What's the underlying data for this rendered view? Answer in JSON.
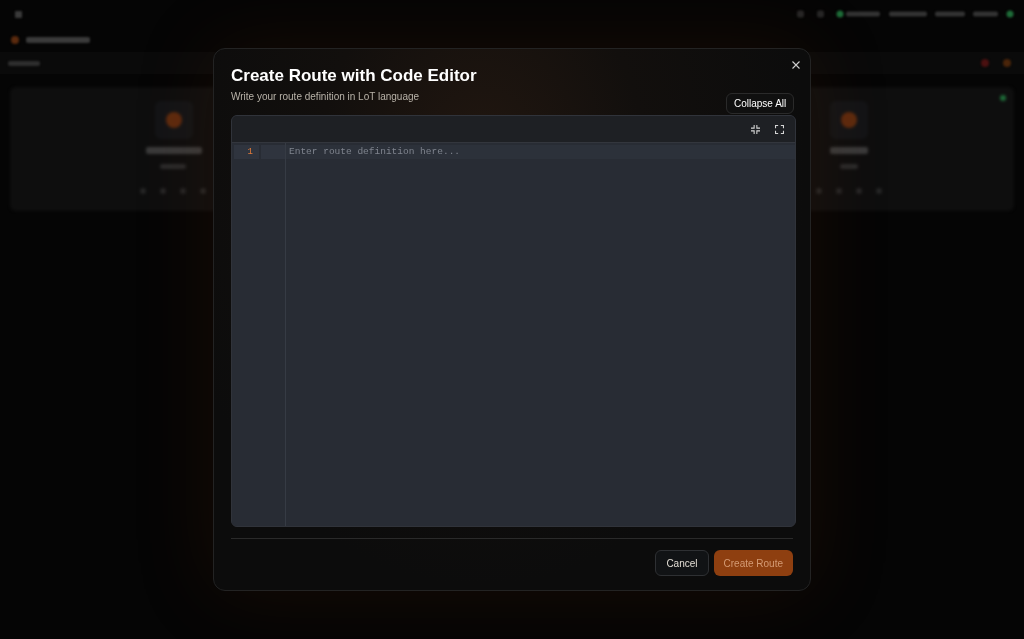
{
  "dialog": {
    "title": "Create Route with Code Editor",
    "subtitle": "Write your route definition in LoT language",
    "tooltip": "Collapse All",
    "editor": {
      "lines": [
        {
          "number": "1",
          "active": true
        }
      ],
      "placeholder": "Enter route definition here..."
    },
    "buttons": [
      {
        "label": "Cancel",
        "kind": "secondary",
        "disabled": false
      },
      {
        "label": "Create Route",
        "kind": "primary",
        "disabled": true
      }
    ]
  }
}
